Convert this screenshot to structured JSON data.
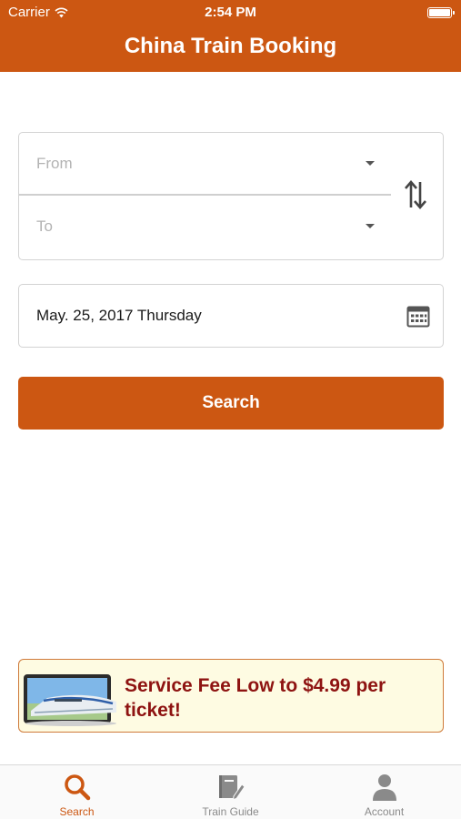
{
  "status_bar": {
    "carrier": "Carrier",
    "time": "2:54 PM"
  },
  "header": {
    "title": "China Train Booking"
  },
  "route": {
    "from_placeholder": "From",
    "to_placeholder": "To",
    "swap_icon": "swap-vertical-arrows-icon"
  },
  "date": {
    "value": "May. 25, 2017 Thursday",
    "icon": "calendar-icon"
  },
  "search": {
    "label": "Search"
  },
  "promo": {
    "text": "Service Fee Low to $4.99 per ticket!",
    "image": "high-speed-train-on-tablet"
  },
  "tabs": [
    {
      "label": "Search",
      "icon": "search-icon",
      "active": true
    },
    {
      "label": "Train Guide",
      "icon": "book-edit-icon",
      "active": false
    },
    {
      "label": "Account",
      "icon": "person-icon",
      "active": false
    }
  ],
  "colors": {
    "brand": "#cc5712",
    "promo_text": "#8e1311",
    "promo_bg": "#fefbe2",
    "inactive_tab": "#8a8a8a"
  }
}
